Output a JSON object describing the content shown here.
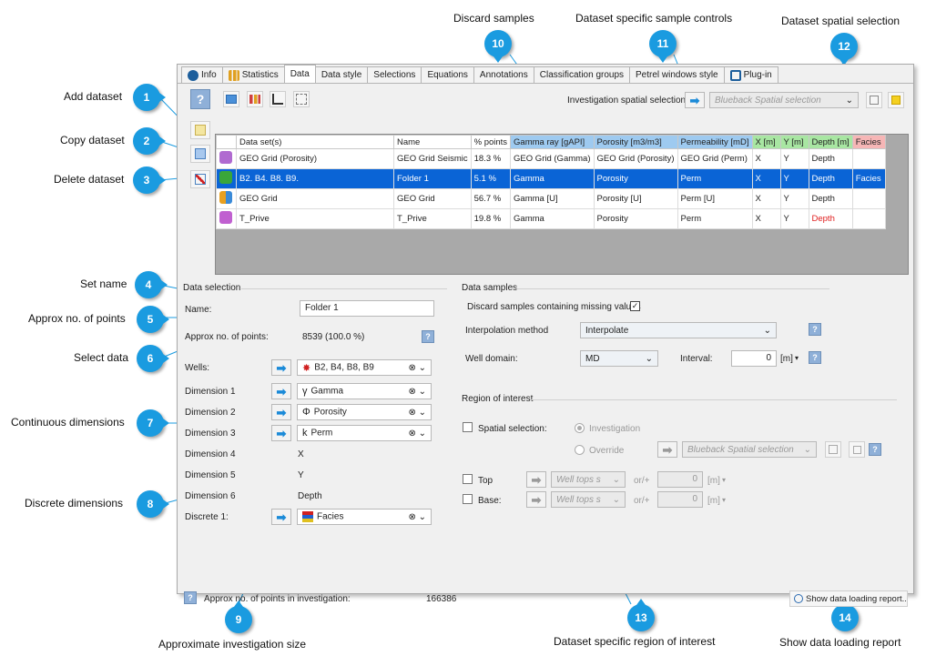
{
  "callouts": {
    "c1": {
      "num": "1",
      "label": "Add dataset"
    },
    "c2": {
      "num": "2",
      "label": "Copy dataset"
    },
    "c3": {
      "num": "3",
      "label": "Delete dataset"
    },
    "c4": {
      "num": "4",
      "label": "Set name"
    },
    "c5": {
      "num": "5",
      "label": "Approx no. of points"
    },
    "c6": {
      "num": "6",
      "label": "Select data"
    },
    "c7": {
      "num": "7",
      "label": "Continuous dimensions"
    },
    "c8": {
      "num": "8",
      "label": "Discrete dimensions"
    },
    "c9": {
      "num": "9",
      "label": "Approximate investigation size"
    },
    "c10": {
      "num": "10",
      "label": "Discard samples"
    },
    "c11": {
      "num": "11",
      "label": "Dataset specific sample controls"
    },
    "c12": {
      "num": "12",
      "label": "Dataset spatial selection"
    },
    "c13": {
      "num": "13",
      "label": "Dataset specific region of interest"
    },
    "c14": {
      "num": "14",
      "label": "Show data loading report"
    }
  },
  "tabs": [
    {
      "label": "Info"
    },
    {
      "label": "Statistics"
    },
    {
      "label": "Data"
    },
    {
      "label": "Data style"
    },
    {
      "label": "Selections"
    },
    {
      "label": "Equations"
    },
    {
      "label": "Annotations"
    },
    {
      "label": "Classification groups"
    },
    {
      "label": "Petrel windows style"
    },
    {
      "label": "Plug-in"
    }
  ],
  "toolbar": {
    "help_label": "?",
    "investigation_spatial_label": "Investigation spatial selection",
    "spatial_value": "Blueback Spatial selection"
  },
  "table": {
    "headers": [
      "Data set(s)",
      "Name",
      "% points",
      "Gamma ray [gAPI]",
      "Porosity [m3/m3]",
      "Permeability [mD]",
      "X [m]",
      "Y [m]",
      "Depth [m]",
      "Facies"
    ],
    "rows": [
      [
        "GEO Grid (Porosity)",
        "GEO Grid Seismic",
        "18.3 %",
        "GEO Grid (Gamma)",
        "GEO Grid (Porosity)",
        "GEO Grid (Perm)",
        "X",
        "Y",
        "Depth",
        ""
      ],
      [
        "B2. B4. B8. B9.",
        "Folder 1",
        "5.1 %",
        "Gamma",
        "Porosity",
        "Perm",
        "X",
        "Y",
        "Depth",
        "Facies"
      ],
      [
        "GEO Grid",
        "GEO Grid",
        "56.7 %",
        "Gamma [U]",
        "Porosity [U]",
        "Perm [U]",
        "X",
        "Y",
        "Depth",
        ""
      ],
      [
        "T_Prive",
        "T_Prive",
        "19.8 %",
        "Gamma",
        "Porosity",
        "Perm",
        "X",
        "Y",
        "Depth",
        ""
      ]
    ],
    "icon_colors": [
      "#b06ad0",
      "#3aa63a",
      "#e8a020",
      "#c060d0"
    ],
    "red_cell_color": "#e02020"
  },
  "data_selection": {
    "title": "Data selection",
    "name_label": "Name:",
    "name_value": "Folder 1",
    "approx_label": "Approx no. of points:",
    "approx_value": "8539 (100.0 %)",
    "wells_label": "Wells:",
    "wells_value": "B2, B4, B8, B9",
    "dim1_label": "Dimension 1",
    "dim1_value": "Gamma",
    "dim2_label": "Dimension 2",
    "dim2_value": "Porosity",
    "dim3_label": "Dimension 3",
    "dim3_value": "Perm",
    "dim4_label": "Dimension 4",
    "dim4_value": "X",
    "dim5_label": "Dimension 5",
    "dim5_value": "Y",
    "dim6_label": "Dimension 6",
    "dim6_value": "Depth",
    "disc1_label": "Discrete 1:",
    "disc1_value": "Facies",
    "footer_label": "Approx no. of points in investigation:",
    "footer_value": "166386"
  },
  "data_samples": {
    "title": "Data samples",
    "discard_label": "Discard samples containing missing values",
    "discard_checked": "✓",
    "interp_label": "Interpolation method",
    "interp_value": "Interpolate",
    "well_domain_label": "Well domain:",
    "well_domain_value": "MD",
    "interval_label": "Interval:",
    "interval_value": "0",
    "interval_unit": "[m]"
  },
  "roi": {
    "title": "Region of interest",
    "spatial_label": "Spatial selection:",
    "investigation_label": "Investigation",
    "override_label": "Override",
    "override_value": "Blueback Spatial selection",
    "top_label": "Top",
    "top_combo": "Well tops s",
    "top_op": "or/+",
    "top_value": "0",
    "top_unit": "[m]",
    "base_label": "Base:",
    "base_combo": "Well tops s",
    "base_op": "or/+",
    "base_value": "0",
    "base_unit": "[m]"
  },
  "report_button": "Show data loading report.."
}
